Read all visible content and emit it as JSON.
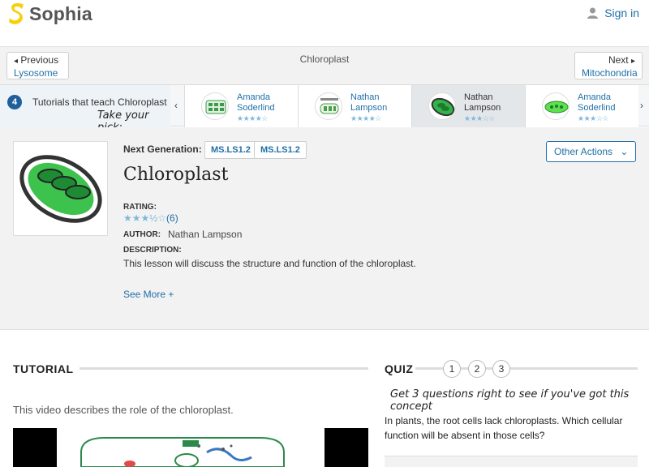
{
  "header": {
    "brand": "Sophia",
    "signin": "Sign in"
  },
  "nav": {
    "title": "Chloroplast",
    "prev": {
      "label": "Previous",
      "topic": "Lysosome"
    },
    "next": {
      "label": "Next",
      "topic": "Mitochondria"
    }
  },
  "tutorials_bar": {
    "count": "4",
    "label": "Tutorials that teach Chloroplast",
    "pick": "Take your pick:",
    "cards": [
      {
        "name1": "Amanda",
        "name2": "Soderlind",
        "stars": "★★★★☆",
        "active": false
      },
      {
        "name1": "Nathan",
        "name2": "Lampson",
        "stars": "★★★★☆",
        "active": false
      },
      {
        "name1": "Nathan",
        "name2": "Lampson",
        "stars": "★★★☆☆",
        "active": true
      },
      {
        "name1": "Amanda",
        "name2": "Soderlind",
        "stars": "★★★☆☆",
        "active": false
      }
    ]
  },
  "lesson": {
    "next_gen_label": "Next Generation:",
    "standards": [
      "MS.LS1.2",
      "MS.LS1.2"
    ],
    "title": "Chloroplast",
    "rating_label": "RATING:",
    "rating_stars": "★★★½☆",
    "rating_count": "(6)",
    "author_label": "AUTHOR:",
    "author": "Nathan Lampson",
    "description_label": "DESCRIPTION:",
    "description": "This lesson will discuss the structure and function of the chloroplast.",
    "see_more": "See More +",
    "other_actions": "Other Actions"
  },
  "tutorial": {
    "heading": "TUTORIAL",
    "video_desc": "This video describes the role of the chloroplast."
  },
  "quiz": {
    "heading": "QUIZ",
    "numbers": [
      "1",
      "2",
      "3"
    ],
    "hint": "Get 3 questions right to see if you've got this concept",
    "question": "In plants, the root cells lack chloroplasts. Which cellular function will be absent in those cells?"
  },
  "colors": {
    "brand_yellow": "#f5d10a",
    "link_blue": "#1f6fa8",
    "badge_blue": "#1f5f9c",
    "chloro_green": "#33b44a"
  }
}
